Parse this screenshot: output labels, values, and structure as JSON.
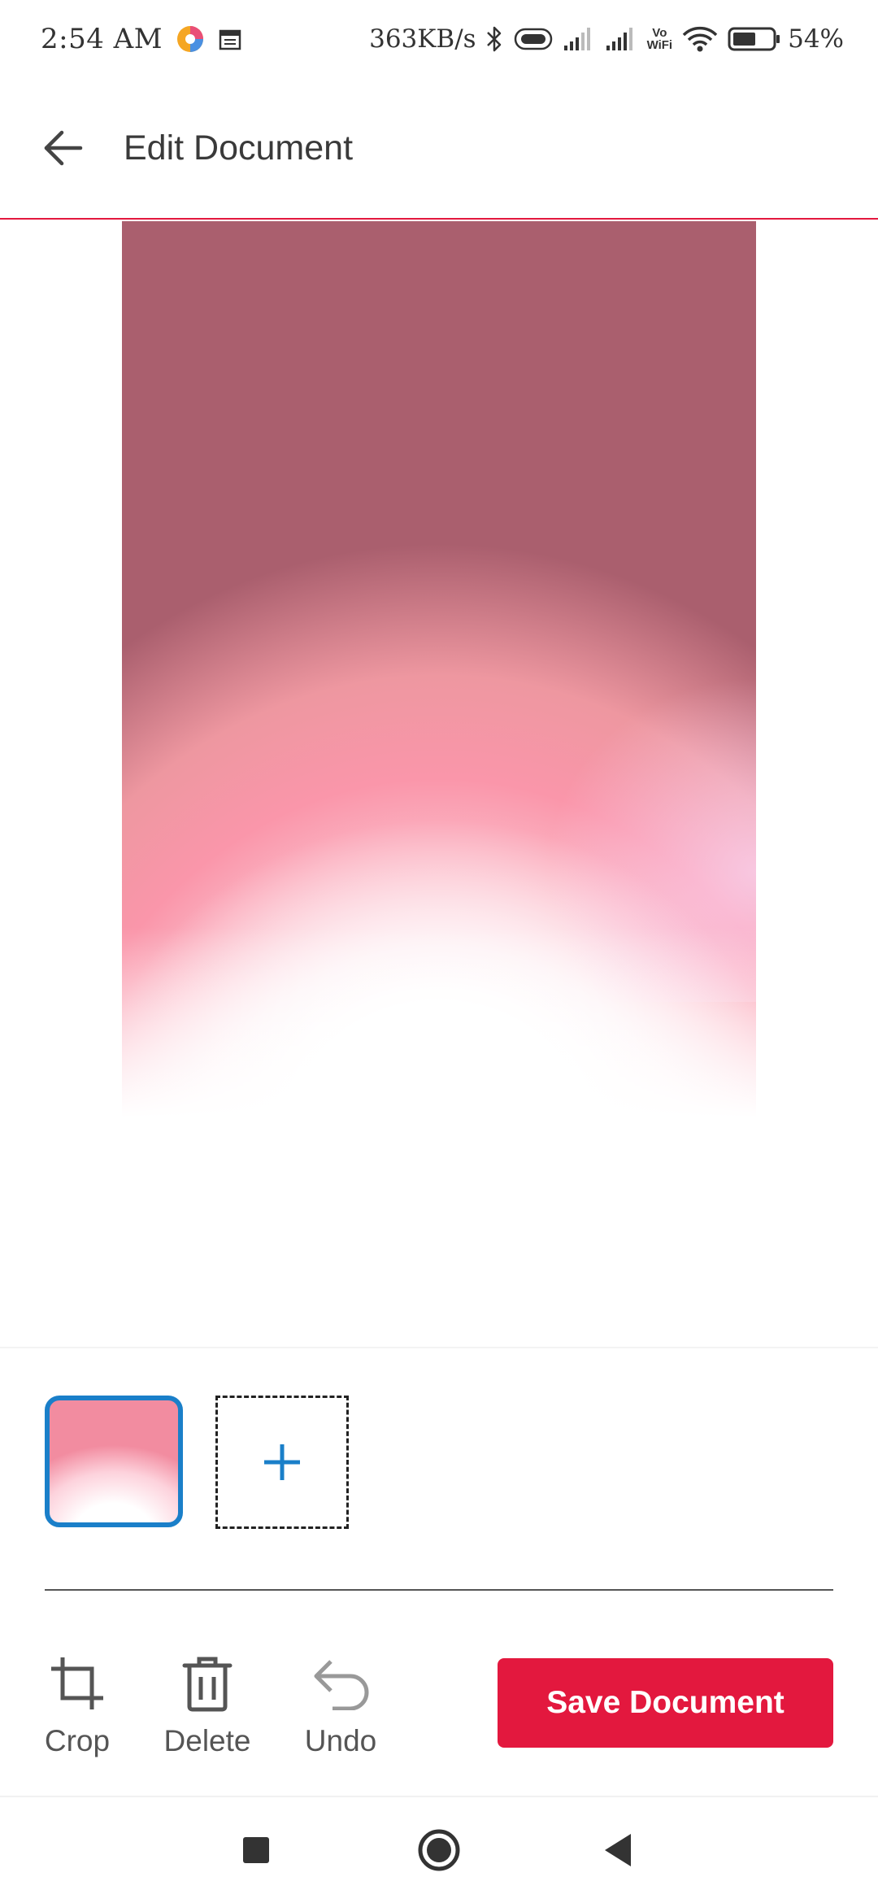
{
  "status_bar": {
    "time": "2:54 AM",
    "network_speed": "363KB/s",
    "battery_percent": "54%",
    "vowifi_top": "Vo",
    "vowifi_bottom": "WiFi",
    "icons": [
      "app-icon",
      "calendar-icon",
      "bluetooth-icon",
      "vibrate-icon",
      "signal-icon",
      "signal-icon",
      "vowifi-icon",
      "wifi-icon",
      "battery-icon"
    ]
  },
  "app_bar": {
    "title": "Edit Document",
    "back_icon": "arrow-left-icon"
  },
  "pages": {
    "selected_index": 0,
    "add_icon": "plus-icon"
  },
  "toolbar": {
    "crop_label": "Crop",
    "delete_label": "Delete",
    "undo_label": "Undo",
    "save_label": "Save Document"
  },
  "nav": {
    "icons": [
      "recents-icon",
      "home-icon",
      "back-icon"
    ]
  },
  "colors": {
    "accent": "#e3183e",
    "selection": "#1a7fc9",
    "add_plus": "#1a7fc9"
  }
}
